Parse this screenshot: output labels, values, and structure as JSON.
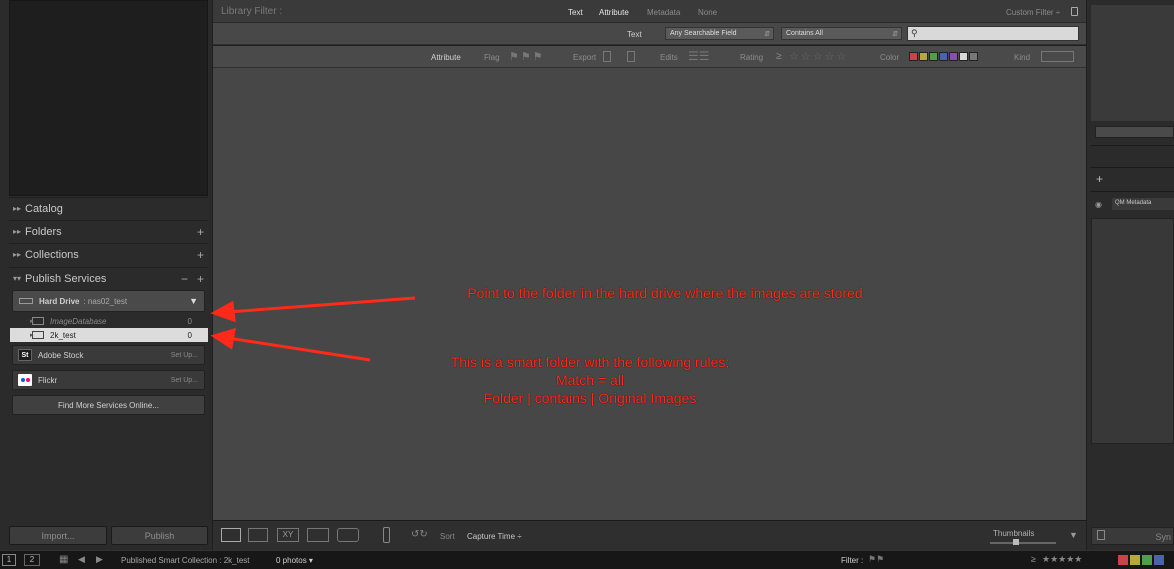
{
  "left_panel": {
    "sections": {
      "catalog": "Catalog",
      "folders": "Folders",
      "collections": "Collections",
      "publish_services": "Publish Services"
    },
    "hard_drive": {
      "label": "Hard Drive",
      "name": ": nas02_test"
    },
    "rows": [
      {
        "label": "ImageDatabase",
        "count": "0"
      },
      {
        "label": "2k_test",
        "count": "0"
      }
    ],
    "adobe_stock": {
      "label": "Adobe Stock",
      "setup": "Set Up...",
      "logo": "St"
    },
    "flickr": {
      "label": "Flickr",
      "setup": "Set Up..."
    },
    "find_more": "Find More Services Online...",
    "import_label": "Import...",
    "publish_label": "Publish"
  },
  "filter_bar": {
    "title": "Library Filter :",
    "tabs": [
      "Text",
      "Attribute",
      "Metadata",
      "None"
    ],
    "custom": "Custom Filter ÷"
  },
  "text_bar": {
    "label": "Text",
    "field": "Any Searchable Field",
    "rule": "Contains All"
  },
  "attr_bar": {
    "attribute": "Attribute",
    "flag": "Flag",
    "export": "Export",
    "edits": "Edits",
    "rating": "Rating",
    "rating_op": "≥",
    "color": "Color",
    "kind": "Kind"
  },
  "colors": [
    "#c9444a",
    "#b8a83a",
    "#4f9e4a",
    "#4a63b0",
    "#8a4fa8",
    "#d8d8d8",
    "#777777"
  ],
  "toolbar": {
    "sort_label": "Sort",
    "sort_value": "Capture Time ÷",
    "thumbnails": "Thumbnails"
  },
  "right_panel": {
    "metadata": "QM Metadata"
  },
  "filmstrip": {
    "page1": "1",
    "page2": "2",
    "source": "Published Smart Collection : 2k_test",
    "count": "0 photos ▾",
    "filter": "Filter :",
    "rating_op": "≥",
    "end": "★★★★★"
  },
  "annotations": {
    "a1": "Point to the folder in the hard drive where the images are stored",
    "a2_line1": "This is a smart folder with the following rules;",
    "a2_line2": "Match = all",
    "a2_line3": "Folder | contains | Original Images"
  },
  "icons": [
    "chevron-right-icon",
    "plus-icon",
    "minus-icon",
    "lock-icon",
    "search-icon",
    "flag-icon",
    "star-icon",
    "grid-view-icon",
    "loupe-view-icon",
    "compare-view-icon",
    "survey-view-icon",
    "people-view-icon",
    "spray-can-icon",
    "arrow-icon"
  ]
}
